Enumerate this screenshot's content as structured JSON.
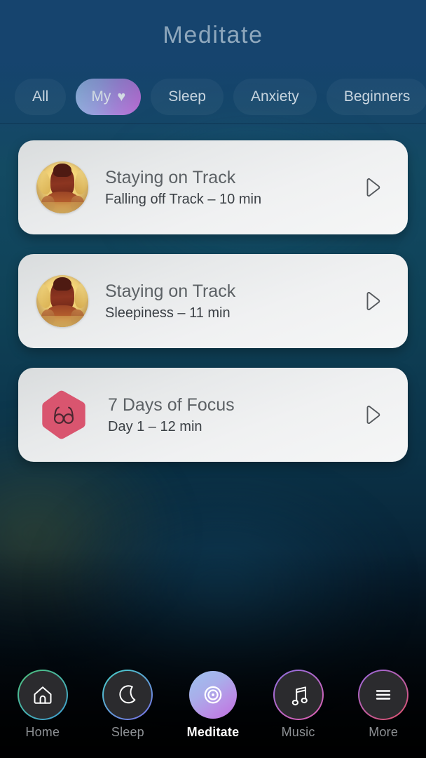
{
  "header": {
    "title": "Meditate"
  },
  "filters": {
    "chips": [
      {
        "label": "All",
        "active": false,
        "icon": null
      },
      {
        "label": "My",
        "active": true,
        "icon": "heart-icon"
      },
      {
        "label": "Sleep",
        "active": false,
        "icon": null
      },
      {
        "label": "Anxiety",
        "active": false,
        "icon": null
      },
      {
        "label": "Beginners",
        "active": false,
        "icon": null
      }
    ]
  },
  "sessions": [
    {
      "title": "Staying on Track",
      "subtitle": "Falling off Track – 10 min",
      "thumb": "meditating-person-photo",
      "action": "play-icon"
    },
    {
      "title": "Staying on Track",
      "subtitle": "Sleepiness – 11 min",
      "thumb": "meditating-person-photo",
      "action": "play-icon"
    },
    {
      "title": "7 Days of Focus",
      "subtitle": "Day 1 – 12 min",
      "thumb": "glasses-hexagon-icon",
      "action": "play-icon"
    }
  ],
  "bottom_nav": [
    {
      "label": "Home",
      "icon": "home-icon",
      "active": false
    },
    {
      "label": "Sleep",
      "icon": "moon-icon",
      "active": false
    },
    {
      "label": "Meditate",
      "icon": "rings-icon",
      "active": true
    },
    {
      "label": "Music",
      "icon": "music-note-icon",
      "active": false
    },
    {
      "label": "More",
      "icon": "hamburger-menu-icon",
      "active": false
    }
  ],
  "colors": {
    "background_top": "#17446e",
    "background_bottom": "#000306",
    "card_background": "#eff0f1",
    "accent_chip_start": "#9fc0ea",
    "accent_chip_end": "#cb70de",
    "hexagon": "#d9556f",
    "title_text": "#5c6165",
    "subtitle_text": "#3b4045",
    "nav_label_inactive": "#8d9195",
    "nav_label_active": "#ffffff"
  }
}
